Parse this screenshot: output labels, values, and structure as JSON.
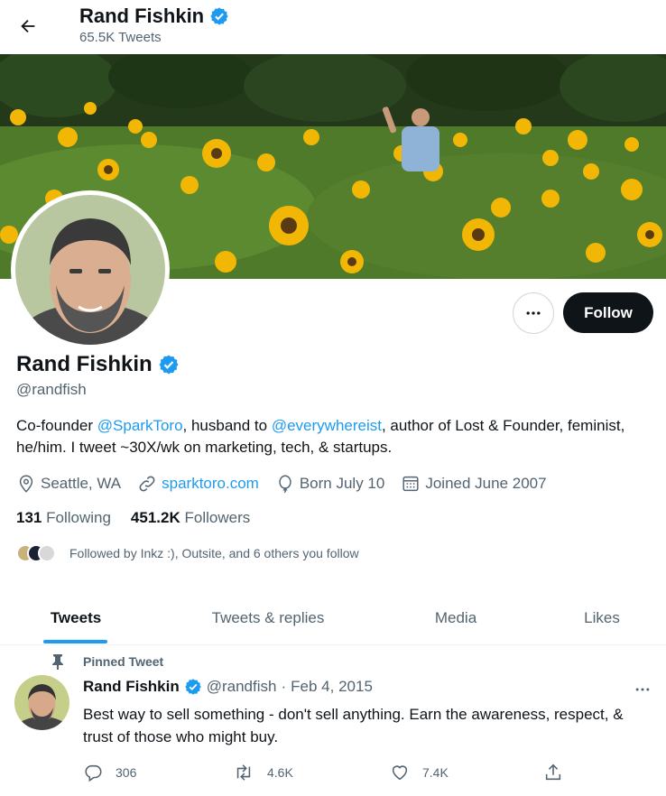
{
  "header": {
    "name": "Rand Fishkin",
    "tweet_count": "65.5K Tweets"
  },
  "profile": {
    "name": "Rand Fishkin",
    "handle": "@randfish",
    "bio": {
      "part1": "Co-founder ",
      "mention1": "@SparkToro",
      "part2": ", husband to ",
      "mention2": "@everywhereist",
      "part3": ", author of Lost & Founder, feminist, he/him. I tweet ~30X/wk on marketing, tech, & startups."
    },
    "location": "Seattle, WA",
    "website": "sparktoro.com",
    "born": "Born July 10",
    "joined": "Joined June 2007",
    "following_count": "131",
    "following_label": "Following",
    "followers_count": "451.2K",
    "followers_label": "Followers",
    "followed_by": "Followed by Inkz :), Outsite, and 6 others you follow"
  },
  "buttons": {
    "follow": "Follow"
  },
  "tabs": [
    {
      "label": "Tweets",
      "active": true
    },
    {
      "label": "Tweets & replies",
      "active": false
    },
    {
      "label": "Media",
      "active": false
    },
    {
      "label": "Likes",
      "active": false
    }
  ],
  "pinned_tweet": {
    "pinned_label": "Pinned Tweet",
    "author": "Rand Fishkin",
    "handle": "@randfish",
    "separator": "·",
    "date": "Feb 4, 2015",
    "text": "Best way to sell something - don't sell anything. Earn the awareness, respect, & trust of those who might buy.",
    "replies": "306",
    "retweets": "4.6K",
    "likes": "7.4K"
  },
  "colors": {
    "accent": "#1d9bf0",
    "text_primary": "#0f1419",
    "text_secondary": "#536471",
    "follow_button": "#0f1419"
  },
  "icons": [
    "back-arrow-icon",
    "verified-badge-icon",
    "more-horizontal-icon",
    "location-pin-icon",
    "link-icon",
    "balloon-icon",
    "calendar-icon",
    "pin-icon",
    "reply-icon",
    "retweet-icon",
    "like-icon",
    "share-icon"
  ]
}
